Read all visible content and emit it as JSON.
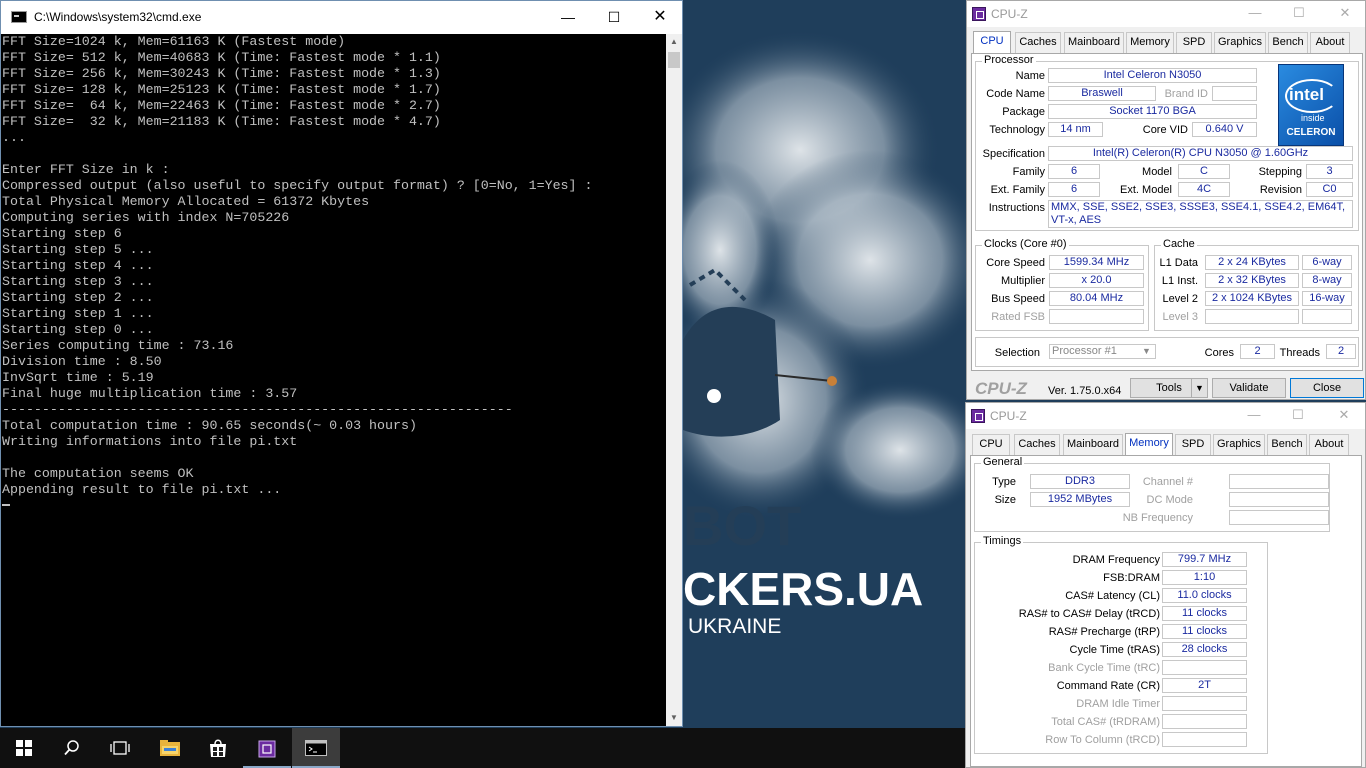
{
  "cmd": {
    "title": "C:\\Windows\\system32\\cmd.exe",
    "lines": [
      "FFT Size=1024 k, Mem=61163 K (Fastest mode)",
      "FFT Size= 512 k, Mem=40683 K (Time: Fastest mode * 1.1)",
      "FFT Size= 256 k, Mem=30243 K (Time: Fastest mode * 1.3)",
      "FFT Size= 128 k, Mem=25123 K (Time: Fastest mode * 1.7)",
      "FFT Size=  64 k, Mem=22463 K (Time: Fastest mode * 2.7)",
      "FFT Size=  32 k, Mem=21183 K (Time: Fastest mode * 4.7)",
      "...",
      "",
      "Enter FFT Size in k :",
      "Compressed output (also useful to specify output format) ? [0=No, 1=Yes] :",
      "Total Physical Memory Allocated = 61372 Kbytes",
      "Computing series with index N=705226",
      "Starting step 6",
      "Starting step 5 ...",
      "Starting step 4 ...",
      "Starting step 3 ...",
      "Starting step 2 ...",
      "Starting step 1 ...",
      "Starting step 0 ...",
      "Series computing time : 73.16",
      "Division time : 8.50",
      "InvSqrt time : 5.19",
      "Final huge multiplication time : 3.57",
      "----------------------------------------------------------------",
      "Total computation time : 90.65 seconds(~ 0.03 hours)",
      "Writing informations into file pi.txt",
      "",
      "The computation seems OK",
      "Appending result to file pi.txt ..."
    ]
  },
  "wallpaper": {
    "text_bot": "BOT",
    "text_ckers": "CKERS.UA",
    "text_ukraine": "UKRAINE"
  },
  "cpuz1": {
    "title": "CPU-Z",
    "tabs": [
      "CPU",
      "Caches",
      "Mainboard",
      "Memory",
      "SPD",
      "Graphics",
      "Bench",
      "About"
    ],
    "active_tab": "CPU",
    "processor": {
      "group": "Processor",
      "name_label": "Name",
      "name": "Intel Celeron N3050",
      "codename_label": "Code Name",
      "codename": "Braswell",
      "brandid_label": "Brand ID",
      "brandid": "",
      "package_label": "Package",
      "package": "Socket 1170 BGA",
      "technology_label": "Technology",
      "technology": "14 nm",
      "corevid_label": "Core VID",
      "corevid": "0.640 V",
      "spec_label": "Specification",
      "spec": "Intel(R) Celeron(R) CPU  N3050  @ 1.60GHz",
      "family_label": "Family",
      "family": "6",
      "model_label": "Model",
      "model": "C",
      "stepping_label": "Stepping",
      "stepping": "3",
      "extfamily_label": "Ext. Family",
      "extfamily": "6",
      "extmodel_label": "Ext. Model",
      "extmodel": "4C",
      "revision_label": "Revision",
      "revision": "C0",
      "instructions_label": "Instructions",
      "instructions": "MMX, SSE, SSE2, SSE3, SSSE3, SSE4.1, SSE4.2, EM64T, VT-x, AES"
    },
    "logo": {
      "brand": "intel",
      "inside": "inside",
      "line": "CELERON"
    },
    "clocks": {
      "group": "Clocks (Core #0)",
      "corespeed_label": "Core Speed",
      "corespeed": "1599.34 MHz",
      "multiplier_label": "Multiplier",
      "multiplier": "x 20.0",
      "busspeed_label": "Bus Speed",
      "busspeed": "80.04 MHz",
      "ratedfsb_label": "Rated FSB",
      "ratedfsb": ""
    },
    "cache": {
      "group": "Cache",
      "l1d_label": "L1 Data",
      "l1d": "2 x 24 KBytes",
      "l1d_way": "6-way",
      "l1i_label": "L1 Inst.",
      "l1i": "2 x 32 KBytes",
      "l1i_way": "8-way",
      "l2_label": "Level 2",
      "l2": "2 x 1024 KBytes",
      "l2_way": "16-way",
      "l3_label": "Level 3",
      "l3": "",
      "l3_way": ""
    },
    "selection_label": "Selection",
    "selection": "Processor #1",
    "cores_label": "Cores",
    "cores": "2",
    "threads_label": "Threads",
    "threads": "2",
    "footer": {
      "brand": "CPU-Z",
      "version": "Ver. 1.75.0.x64",
      "tools": "Tools",
      "validate": "Validate",
      "close": "Close"
    }
  },
  "cpuz2": {
    "title": "CPU-Z",
    "tabs": [
      "CPU",
      "Caches",
      "Mainboard",
      "Memory",
      "SPD",
      "Graphics",
      "Bench",
      "About"
    ],
    "active_tab": "Memory",
    "general": {
      "group": "General",
      "type_label": "Type",
      "type": "DDR3",
      "size_label": "Size",
      "size": "1952 MBytes",
      "channel_label": "Channel #",
      "channel": "",
      "dcmode_label": "DC Mode",
      "dcmode": "",
      "nbfreq_label": "NB Frequency",
      "nbfreq": ""
    },
    "timings": {
      "group": "Timings",
      "rows": [
        {
          "label": "DRAM Frequency",
          "value": "799.7 MHz",
          "dim": false
        },
        {
          "label": "FSB:DRAM",
          "value": "1:10",
          "dim": false
        },
        {
          "label": "CAS# Latency (CL)",
          "value": "11.0 clocks",
          "dim": false
        },
        {
          "label": "RAS# to CAS# Delay (tRCD)",
          "value": "11 clocks",
          "dim": false
        },
        {
          "label": "RAS# Precharge (tRP)",
          "value": "11 clocks",
          "dim": false
        },
        {
          "label": "Cycle Time (tRAS)",
          "value": "28 clocks",
          "dim": false
        },
        {
          "label": "Bank Cycle Time (tRC)",
          "value": "",
          "dim": true
        },
        {
          "label": "Command Rate (CR)",
          "value": "2T",
          "dim": false
        },
        {
          "label": "DRAM Idle Timer",
          "value": "",
          "dim": true
        },
        {
          "label": "Total CAS# (tRDRAM)",
          "value": "",
          "dim": true
        },
        {
          "label": "Row To Column (tRCD)",
          "value": "",
          "dim": true
        }
      ]
    }
  },
  "taskbar": {
    "items": [
      "start",
      "search",
      "task-view",
      "file-explorer",
      "store",
      "cpu-z",
      "command-prompt"
    ]
  }
}
